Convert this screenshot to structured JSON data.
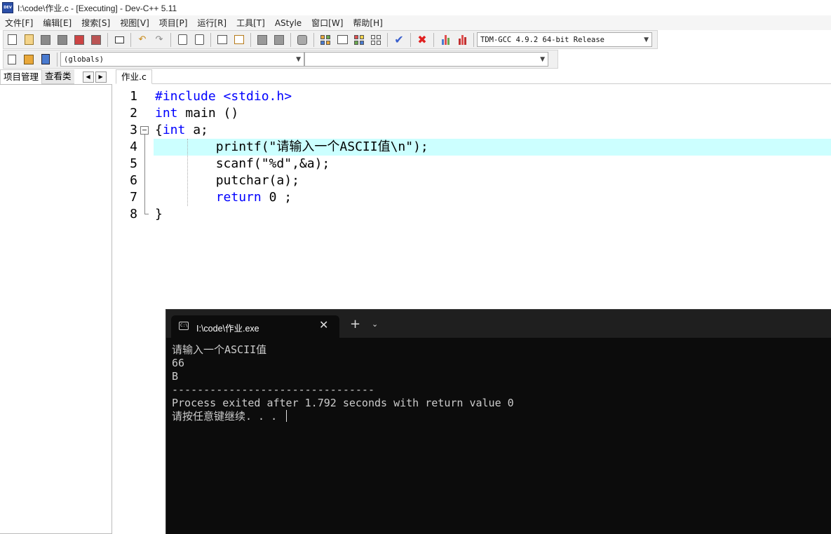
{
  "window": {
    "title": "I:\\code\\作业.c - [Executing] - Dev-C++ 5.11",
    "icon_label": "DEV"
  },
  "menu": {
    "items": [
      "文件[F]",
      "编辑[E]",
      "搜索[S]",
      "视图[V]",
      "项目[P]",
      "运行[R]",
      "工具[T]",
      "AStyle",
      "窗口[W]",
      "帮助[H]"
    ]
  },
  "toolbar": {
    "compiler_select": "TDM-GCC 4.9.2 64-bit Release",
    "scope_select": "(globals)",
    "function_select": ""
  },
  "left_panel": {
    "tabs": [
      "项目管理",
      "查看类"
    ]
  },
  "editor": {
    "file_tab": "作业.c",
    "lines": [
      {
        "num": "1",
        "text": "#include <stdio.h>"
      },
      {
        "num": "2",
        "text": "int main ()"
      },
      {
        "num": "3",
        "text": "{int a;"
      },
      {
        "num": "4",
        "text": "        printf(\"请输入一个ASCII值\\n\");"
      },
      {
        "num": "5",
        "text": "        scanf(\"%d\",&a);"
      },
      {
        "num": "6",
        "text": "        putchar(a);"
      },
      {
        "num": "7",
        "text": "        return 0 ;"
      },
      {
        "num": "8",
        "text": "}"
      }
    ]
  },
  "console": {
    "tab_title": "I:\\code\\作业.exe",
    "icon_label": "C:\\",
    "close_glyph": "✕",
    "new_tab_glyph": "+",
    "dropdown_glyph": "⌄",
    "output": [
      "请输入一个ASCII值",
      "66",
      "B",
      "--------------------------------",
      "Process exited after 1.792 seconds with return value 0",
      "请按任意键继续. . . "
    ]
  },
  "colors": {
    "keyword": "#0000ff",
    "current_line": "#ccffff",
    "console_bg": "#0c0c0c",
    "console_text": "#cccccc"
  }
}
